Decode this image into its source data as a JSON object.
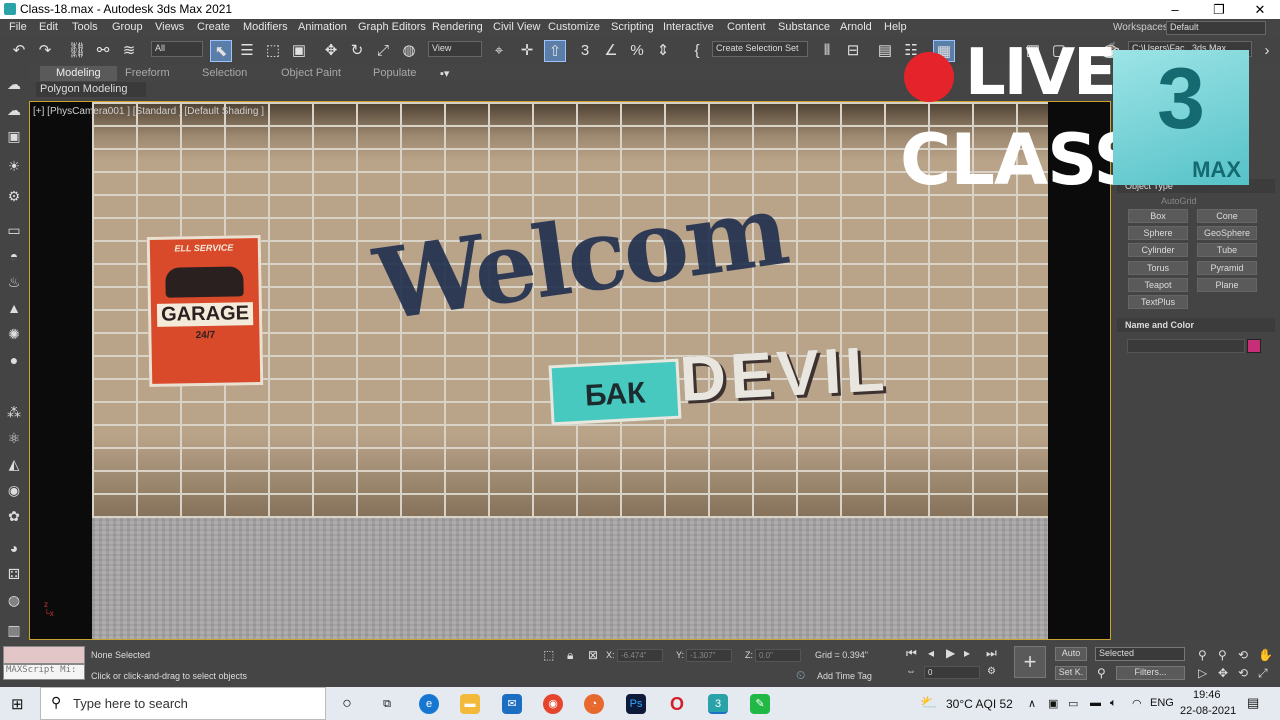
{
  "titlebar": {
    "title": "Class-18.max - Autodesk 3ds Max 2021",
    "minimize": "–",
    "maximize": "❐",
    "close": "✕"
  },
  "menubar": {
    "items": [
      "File",
      "Edit",
      "Tools",
      "Group",
      "Views",
      "Create",
      "Modifiers",
      "Animation",
      "Graph Editors",
      "Rendering",
      "Civil View",
      "Customize",
      "Scripting",
      "Interactive",
      "Content",
      "Substance",
      "Arnold",
      "Help"
    ],
    "workspaces_label": "Workspaces:",
    "workspaces_value": "Default"
  },
  "toolbar": {
    "filter_value": "All",
    "view_value": "View",
    "selection_set": "Create Selection Set",
    "path_value": "C:\\Users\\Fac...3ds Max 2021"
  },
  "ribbon": {
    "tabs": [
      "Modeling",
      "Freeform",
      "Selection",
      "Object Paint",
      "Populate"
    ],
    "active_tab": "Modeling",
    "sub_label": "Polygon Modeling"
  },
  "viewport": {
    "label": "[+] [PhysCamera001 ] [Standard ] [Default Shading ]",
    "poster": {
      "top": "ELL SERVICE",
      "main": "GARAGE",
      "sub": "24/7"
    },
    "graffiti_welcome": "Welcom",
    "graffiti_teal": "БАК",
    "graffiti_white": "DEVIL"
  },
  "command_panel": {
    "section_object_type": "Object Type",
    "autogrid": "AutoGrid",
    "object_buttons": [
      "Box",
      "Cone",
      "Sphere",
      "GeoSphere",
      "Cylinder",
      "Tube",
      "Torus",
      "Pyramid",
      "Teapot",
      "Plane",
      "TextPlus"
    ],
    "section_name_color": "Name and Color",
    "swatch_color": "#c62f78"
  },
  "overlay": {
    "live": "LIVE",
    "class": "CLASS",
    "logo_number": "3",
    "logo_text": "MAX"
  },
  "status": {
    "maxscript": "MAXScript Mi:",
    "selection": "None Selected",
    "prompt": "Click or click-and-drag to select objects",
    "x_label": "X:",
    "x_value": "-6.474\"",
    "y_label": "Y:",
    "y_value": "-1.307\"",
    "z_label": "Z:",
    "z_value": "0.0\"",
    "grid": "Grid = 0.394\"",
    "add_time_tag": "Add Time Tag",
    "frame": "0",
    "auto": "Auto",
    "setk": "Set K.",
    "selected": "Selected",
    "filters": "Filters..."
  },
  "taskbar": {
    "search_placeholder": "Type here to search",
    "weather": "30°C  AQI 52",
    "lang": "ENG",
    "time": "19:46",
    "date": "22-08-2021"
  }
}
